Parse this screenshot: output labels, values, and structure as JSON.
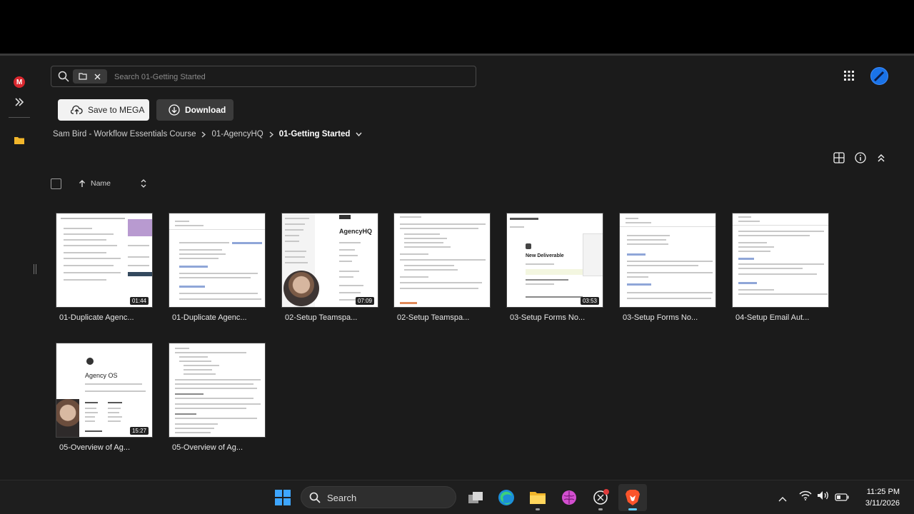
{
  "search": {
    "placeholder": "Search 01-Getting Started"
  },
  "actions": {
    "save_label": "Save to MEGA",
    "download_label": "Download"
  },
  "breadcrumb": {
    "items": [
      "Sam Bird - Workflow Essentials Course",
      "01-AgencyHQ"
    ],
    "current": "01-Getting Started"
  },
  "list_header": {
    "sort_label": "Name"
  },
  "files": [
    {
      "name": "01-Duplicate Agenc...",
      "duration": "01:44"
    },
    {
      "name": "01-Duplicate Agenc...",
      "duration": ""
    },
    {
      "name": "02-Setup Teamspa...",
      "duration": "07:09",
      "thumb_title": "AgencyHQ"
    },
    {
      "name": "02-Setup Teamspa...",
      "duration": ""
    },
    {
      "name": "03-Setup Forms No...",
      "duration": "03:53",
      "thumb_title": "New Deliverable"
    },
    {
      "name": "03-Setup Forms No...",
      "duration": ""
    },
    {
      "name": "04-Setup Email Aut...",
      "duration": ""
    },
    {
      "name": "05-Overview of Ag...",
      "duration": "15:27",
      "thumb_title": "Agency OS"
    },
    {
      "name": "05-Overview of Ag...",
      "duration": ""
    }
  ],
  "taskbar": {
    "search_label": "Search",
    "time": "11:25 PM",
    "date": "3/11/2026"
  },
  "colors": {
    "mega_red": "#d9272e",
    "background": "#1b1b1b",
    "folder": "#f2b62b"
  }
}
